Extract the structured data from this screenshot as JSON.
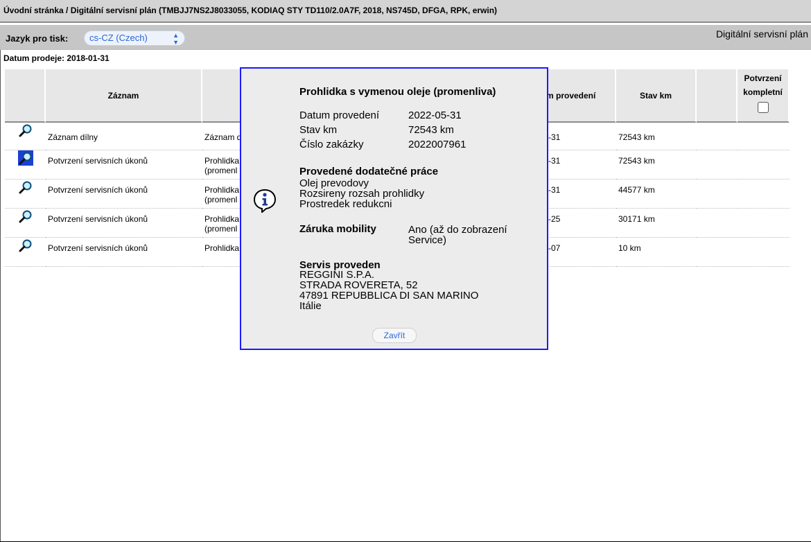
{
  "breadcrumb": "Úvodní stránka / Digitální servisní plán (TMBJJ7NS2J8033055, KODIAQ STY TD110/2.0A7F, 2018, NS745D, DFGA, RPK, erwin)",
  "lang": {
    "label": "Jazyk pro tisk:",
    "selected": "cs-CZ (Czech)"
  },
  "brand": "Digitální servisní plán",
  "sale_date": "Datum prodeje: 2018-01-31",
  "table": {
    "headers": {
      "record": "Záznam",
      "date": "m provedení",
      "km": "Stav km",
      "confirm": "Potvrzení kompletní"
    },
    "rows": [
      {
        "record": "Záznam dílny",
        "desc": "Záznam d",
        "date": "-31",
        "km": "72543 km"
      },
      {
        "record": "Potvrzení servisních úkonů",
        "desc": "Prohlidka\n(promenl",
        "date": "-31",
        "km": "72543 km"
      },
      {
        "record": "Potvrzení servisních úkonů",
        "desc": "Prohlidka\n(promenl",
        "date": "-31",
        "km": "44577 km"
      },
      {
        "record": "Potvrzení servisních úkonů",
        "desc": "Prohlidka\n(promenl",
        "date": "-25",
        "km": "30171 km"
      },
      {
        "record": "Potvrzení servisních úkonů",
        "desc": "Prohlidka",
        "date": "-07",
        "km": "10 km"
      }
    ]
  },
  "modal": {
    "title": "Prohlidka s vymenou oleje (promenliva)",
    "fields": [
      {
        "label": "Datum provedení",
        "value": "2022-05-31"
      },
      {
        "label": "Stav km",
        "value": "72543 km"
      },
      {
        "label": "Číslo zakázky",
        "value": "2022007961"
      }
    ],
    "extra_heading": "Provedené dodatečné práce",
    "extra_items": [
      "Olej prevodovy",
      "Rozsireny rozsah prohlidky",
      "Prostredek redukcni"
    ],
    "mobility_label": "Záruka mobility",
    "mobility_value_1": "Ano (až do zobrazení",
    "mobility_value_2": "Service)",
    "service_heading": "Servis proveden",
    "service_lines": [
      "REGGINI S.P.A.",
      "STRADA ROVERETA, 52",
      "47891 REPUBBLICA DI SAN MARINO",
      "Itálie"
    ],
    "close_label": "Zavřít"
  },
  "colors": {
    "accent": "#2b66d8",
    "modal_border": "#1a1aff",
    "selected_icon": "#1c3fd6"
  }
}
